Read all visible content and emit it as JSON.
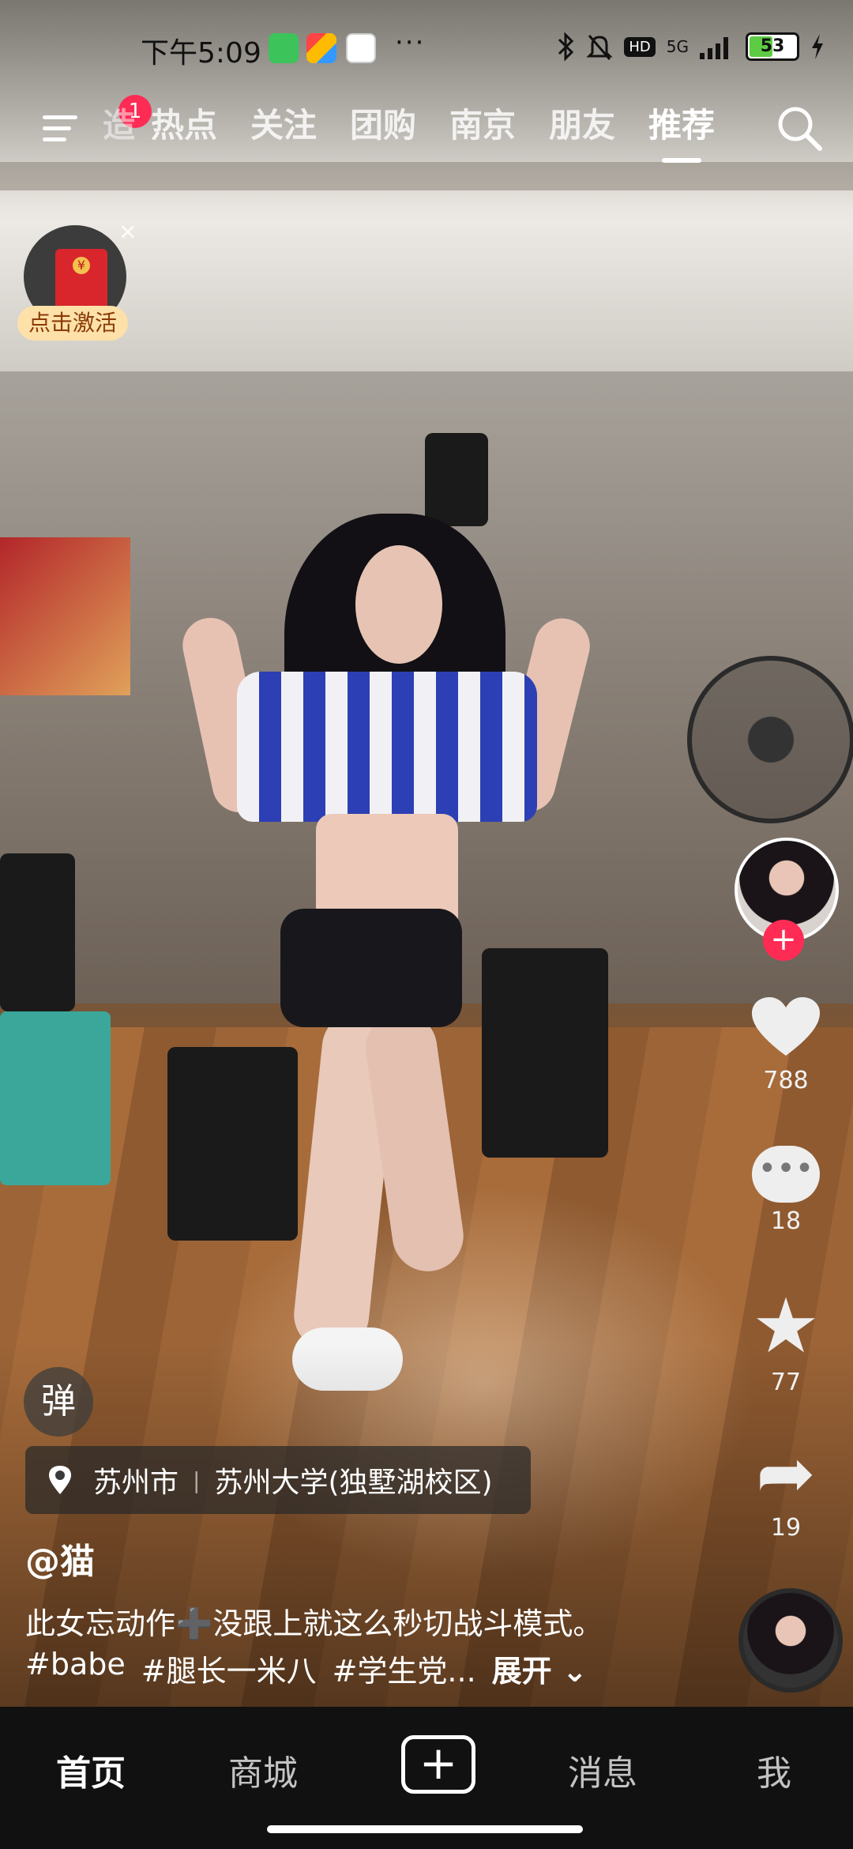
{
  "status_bar": {
    "time": "下午5:09",
    "dots": "···",
    "network": "5G",
    "hd": "HD",
    "battery": "53",
    "battery_level": 0.53
  },
  "top_nav": {
    "badge_count": "1",
    "tabs": [
      {
        "label": "热点"
      },
      {
        "label": "关注"
      },
      {
        "label": "团购"
      },
      {
        "label": "南京"
      },
      {
        "label": "朋友"
      },
      {
        "label": "推荐"
      }
    ],
    "partial_tab": "造"
  },
  "red_packet": {
    "label": "点击激活",
    "close": "×"
  },
  "rail": {
    "follow": "+",
    "likes": "788",
    "comments": "18",
    "favorites": "77",
    "shares": "19"
  },
  "caption": {
    "danmu": "弹",
    "location_city": "苏州市",
    "location_sep": "|",
    "location_place": "苏州大学(独墅湖校区)",
    "author": "@猫",
    "description": "此女忘动作➕没跟上就这么秒切战斗模式。",
    "tags": [
      "#babe",
      "#腿长一米八",
      "#学生党..."
    ],
    "expand": "展开"
  },
  "bottom_nav": {
    "home": "首页",
    "mall": "商城",
    "add": "+",
    "messages": "消息",
    "me": "我"
  },
  "icons": {
    "menu": "menu-icon",
    "search": "search-icon",
    "heart": "heart-icon",
    "comment": "comment-icon",
    "star": "star-icon",
    "share": "share-icon",
    "pin": "location-pin-icon"
  },
  "colors": {
    "accent": "#fe2c55",
    "packet_label_bg": "#fde1a8",
    "battery_fill": "#5ecb45"
  }
}
